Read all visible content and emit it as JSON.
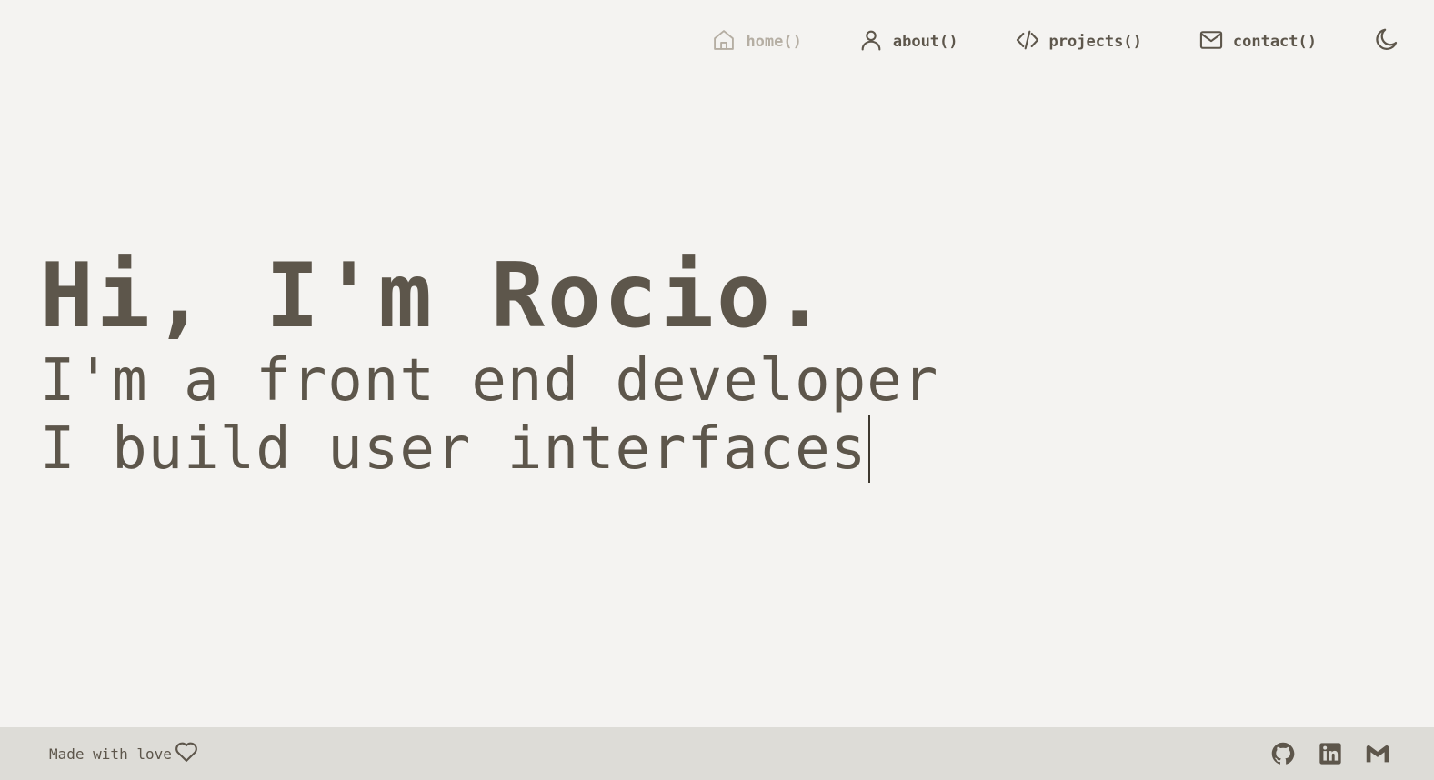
{
  "nav": {
    "items": [
      {
        "label": "home()",
        "icon": "home-icon",
        "active": true
      },
      {
        "label": "about()",
        "icon": "user-icon",
        "active": false
      },
      {
        "label": "projects()",
        "icon": "code-icon",
        "active": false
      },
      {
        "label": "contact()",
        "icon": "mail-icon",
        "active": false
      }
    ],
    "theme_toggle_icon": "moon-icon"
  },
  "hero": {
    "title": "Hi, I'm Rocio.",
    "line1": "I'm a front end developer",
    "line2": "I build user interfaces"
  },
  "footer": {
    "made_with": "Made with love",
    "heart_icon": "heart-icon",
    "social": [
      "github-icon",
      "linkedin-icon",
      "gmail-icon"
    ]
  },
  "colors": {
    "background": "#f4f3f1",
    "text": "#5d564b",
    "active_nav": "#b5aea3",
    "footer_bg": "#dddcd7"
  }
}
